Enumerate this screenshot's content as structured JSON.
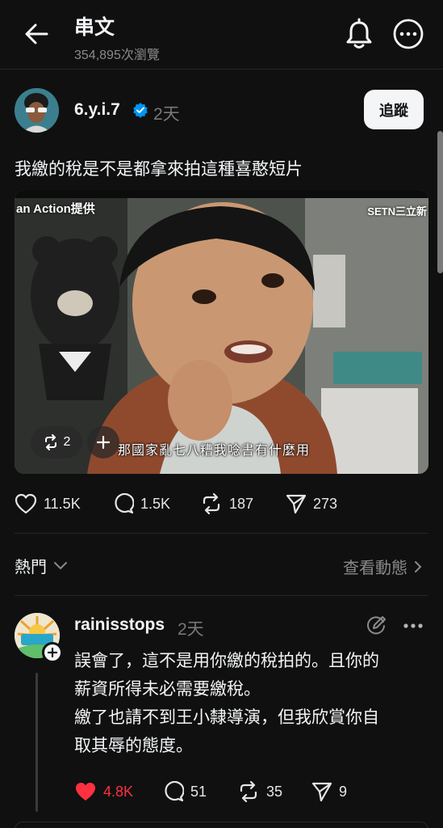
{
  "header": {
    "title": "串文",
    "views": "354,895次瀏覽",
    "icons": [
      "back-arrow-icon",
      "bell-icon",
      "more-icon"
    ]
  },
  "post": {
    "username": "6.y.i.7",
    "time": "2天",
    "follow_label": "追蹤",
    "text": "我繳的稅是不是都拿來拍這種喜憨短片",
    "video": {
      "watermark_left": "an Action提供",
      "watermark_right": "SETN三立新",
      "subtitle": "那國家亂七八糟我唸書有什麼用",
      "repost_count": "2"
    },
    "likes": "11.5K",
    "comments": "1.5K",
    "reposts": "187",
    "shares": "273"
  },
  "sort": {
    "label": "熱門",
    "activity_label": "查看動態"
  },
  "reply": {
    "username": "rainisstops",
    "time": "2天",
    "lines": [
      "誤會了，這不是用你繳的稅拍的。且你的",
      "薪資所得未必需要繳稅。",
      "繳了也請不到王小隸導演，但我欣賞你自",
      "取其辱的態度。"
    ],
    "likes": "4.8K",
    "comments": "51",
    "reposts": "35",
    "shares": "9",
    "like_color": "#ff3040"
  },
  "colors": {
    "background": "#101010",
    "text": "#f3f5f7",
    "muted": "#777777",
    "verified": "#0095f6"
  }
}
